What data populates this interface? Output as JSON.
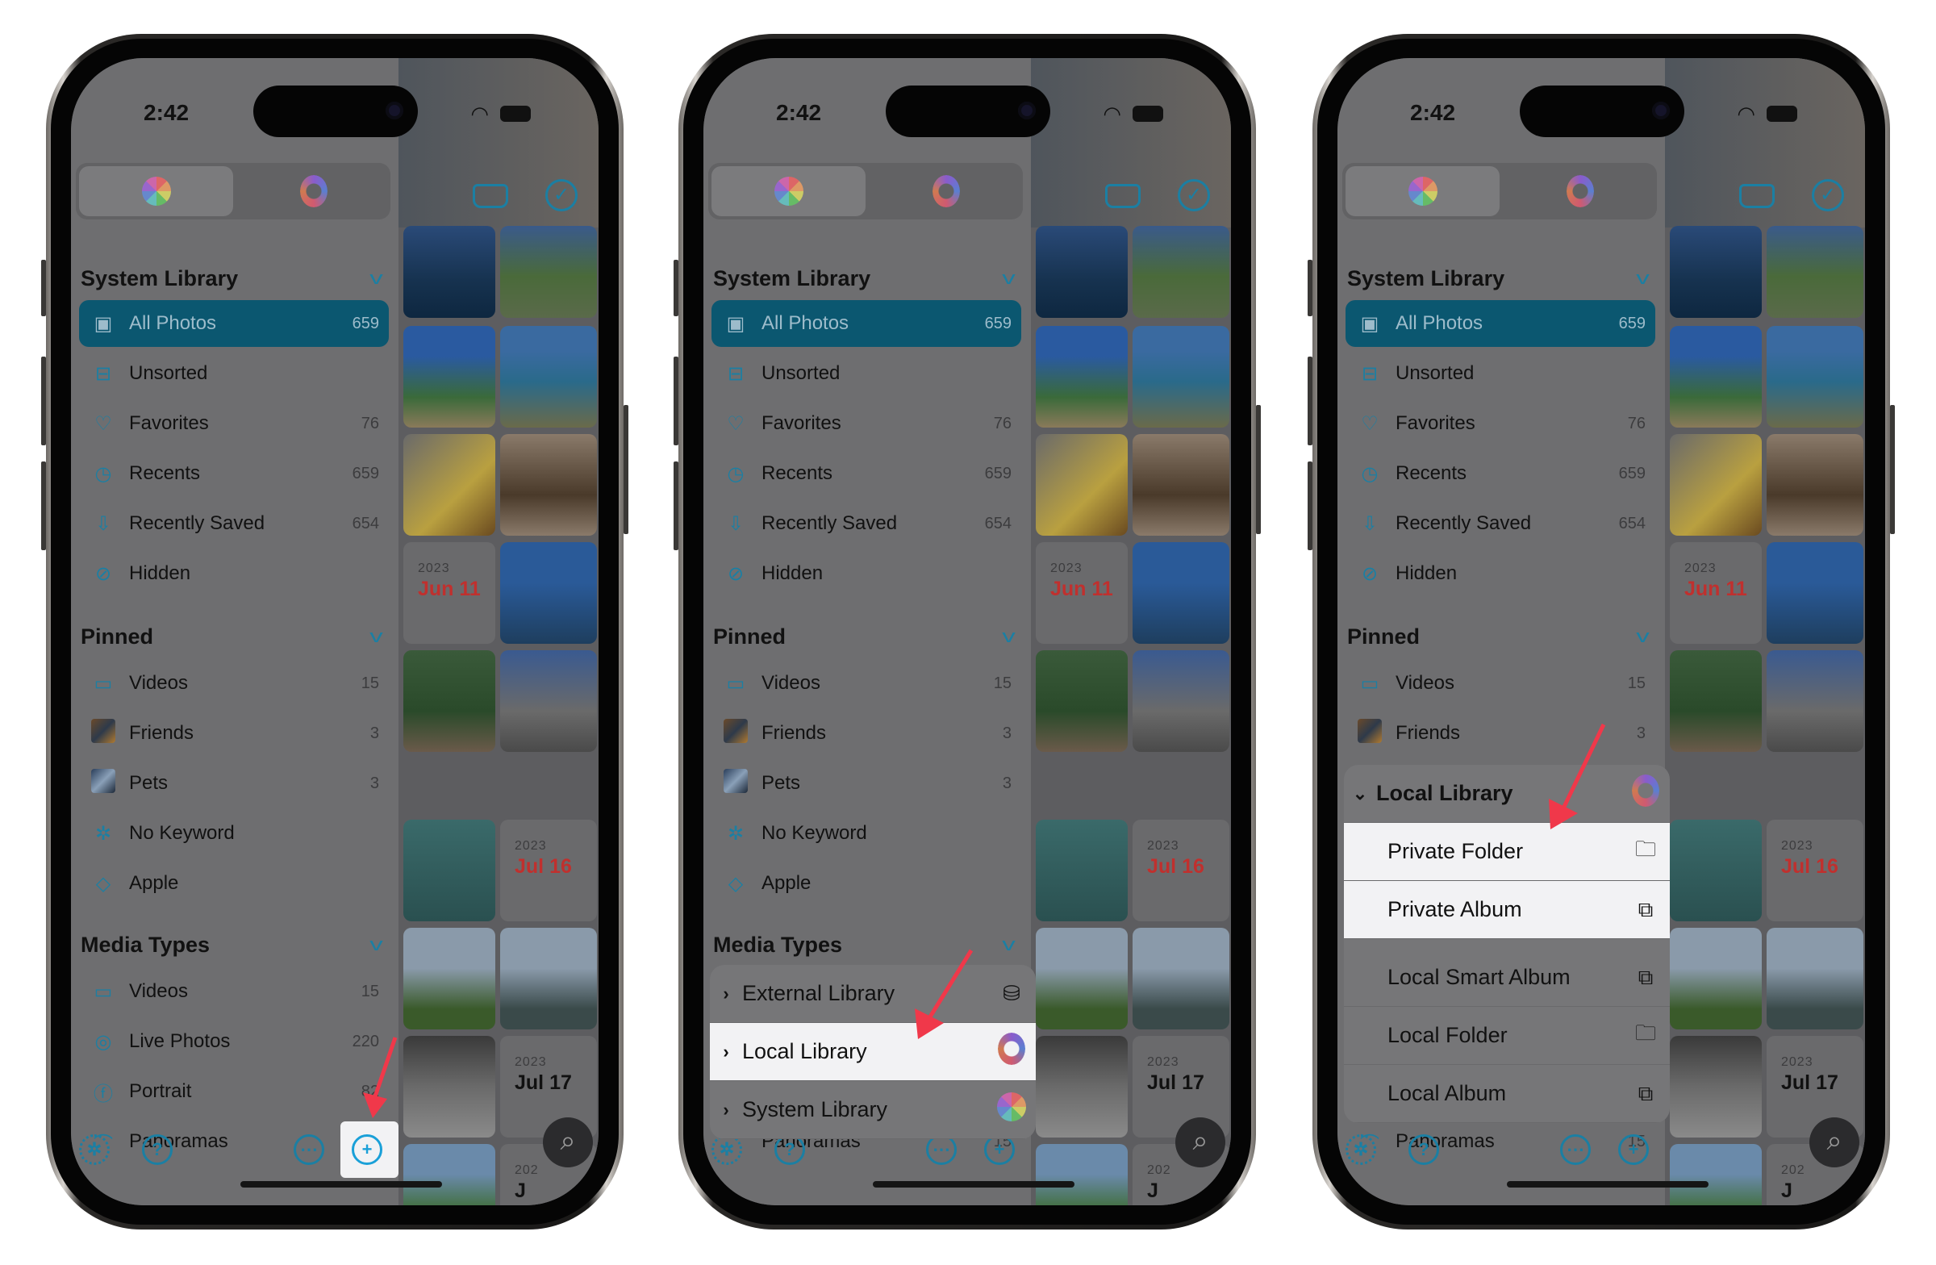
{
  "status": {
    "time": "2:42"
  },
  "segments": [
    {
      "name": "system-photos-library-tab",
      "icon": "photos-flower-icon"
    },
    {
      "name": "local-library-tab",
      "icon": "local-ring-icon"
    }
  ],
  "grid_toolbar": {
    "icons": [
      "inbox-tray-icon",
      "select-check-icon"
    ]
  },
  "sections": {
    "system_library": {
      "title": "System Library",
      "items": [
        {
          "label": "All Photos",
          "count": "659",
          "icon": "photos-stack-icon",
          "selected": true
        },
        {
          "label": "Unsorted",
          "count": "",
          "icon": "tray-icon"
        },
        {
          "label": "Favorites",
          "count": "76",
          "icon": "heart-icon"
        },
        {
          "label": "Recents",
          "count": "659",
          "icon": "clock-icon"
        },
        {
          "label": "Recently Saved",
          "count": "654",
          "icon": "download-icon"
        },
        {
          "label": "Hidden",
          "count": "",
          "icon": "eye-slash-icon"
        }
      ]
    },
    "pinned": {
      "title": "Pinned",
      "items": [
        {
          "label": "Videos",
          "count": "15",
          "icon": "video-icon"
        },
        {
          "label": "Friends",
          "count": "3",
          "icon": "friends-thumbnail"
        },
        {
          "label": "Pets",
          "count": "3",
          "icon": "pets-thumbnail"
        },
        {
          "label": "No Keyword",
          "count": "",
          "icon": "keyword-gear-icon"
        },
        {
          "label": "Apple",
          "count": "",
          "icon": "tag-icon"
        }
      ]
    },
    "media_types": {
      "title": "Media Types",
      "items": [
        {
          "label": "Videos",
          "count": "15",
          "icon": "video-icon"
        },
        {
          "label": "Live Photos",
          "count": "220",
          "icon": "live-photo-icon"
        },
        {
          "label": "Portrait",
          "count": "82",
          "icon": "portrait-f-icon"
        },
        {
          "label": "Panoramas",
          "count": "15",
          "icon": "panorama-icon"
        }
      ]
    }
  },
  "bottom_toolbar": {
    "buttons": [
      "settings-gear",
      "help",
      "more",
      "add"
    ]
  },
  "grid_dates": [
    {
      "year": "2023",
      "date": "Jun 11",
      "color": "#c0302e"
    },
    {
      "year": "2023",
      "date": "Jul 16",
      "color": "#c0302e"
    },
    {
      "year": "2023",
      "date": "Jul 17",
      "color": "#111111"
    },
    {
      "year": "202",
      "date": "J",
      "color": "#111111"
    }
  ],
  "phone2_menu": {
    "items": [
      {
        "label": "External Library",
        "icon": "external-drive-icon"
      },
      {
        "label": "Local Library",
        "icon": "local-ring-icon",
        "highlighted": true
      },
      {
        "label": "System Library",
        "icon": "photos-flower-icon"
      }
    ]
  },
  "phone3_menu": {
    "header": "Local Library",
    "items": [
      {
        "label": "Private Folder",
        "icon": "folder-icon",
        "highlighted": true
      },
      {
        "label": "Private Album",
        "icon": "locked-album-icon",
        "highlighted": true
      },
      {
        "label": "Local Smart Album",
        "icon": "smart-album-gear-icon"
      },
      {
        "label": "Local Folder",
        "icon": "folder-icon"
      },
      {
        "label": "Local Album",
        "icon": "album-icon"
      }
    ]
  },
  "annotation_color": "#f0384a",
  "accent_color": "#1b7fa3"
}
